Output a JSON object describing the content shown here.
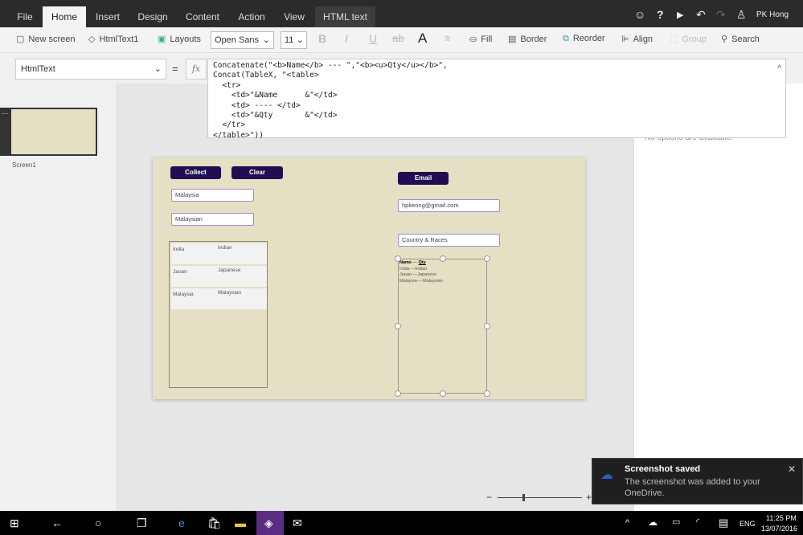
{
  "menu": {
    "tabs": [
      "File",
      "Home",
      "Insert",
      "Design",
      "Content",
      "Action",
      "View",
      "HTML text"
    ],
    "selected": "Home",
    "user": "PK Hong"
  },
  "ribbon": {
    "new_screen": "New screen",
    "control": "HtmlText1",
    "layouts": "Layouts",
    "font": "Open Sans",
    "size": "11",
    "fill": "Fill",
    "border": "Border",
    "reorder": "Reorder",
    "align": "Align",
    "group": "Group",
    "search": "Search"
  },
  "formula_bar": {
    "property": "HtmlText",
    "equals": "=",
    "fx": "fx",
    "formula": "Concatenate(\"<b>Name</b> --- \",\"<b><u>Qty</u></b>\",\nConcat(TableX, \"<table>\n  <tr>\n    <td>\"&Name      &\"</td>\n    <td> ---- </td>\n    <td>\"&Qty       &\"</td>\n  </tr>\n</table>\"))"
  },
  "screens": [
    {
      "name": "Screen1"
    }
  ],
  "right_panel": {
    "message": "No options are available."
  },
  "app": {
    "collect": "Collect",
    "clear": "Clear",
    "email": "Email",
    "input_country": "Malaysia",
    "input_race": "Malaysian",
    "email_value": "hpkeong@gmail.com",
    "subject_value": "Country & Races",
    "gallery": [
      {
        "name": "India",
        "qty": "Indian"
      },
      {
        "name": "Jaoan",
        "qty": "Japanese"
      },
      {
        "name": "Malaysia",
        "qty": "Malaysian"
      }
    ],
    "html_header_name": "Name",
    "html_header_sep": " --- ",
    "html_header_qty": "Qty",
    "html_lines": [
      "India----Indian",
      "Jaoan----Japanese",
      "Malaysia----Malaysian"
    ]
  },
  "zoom": {
    "minus": "−",
    "plus": "+",
    "level": 0.35
  },
  "toast": {
    "title": "Screenshot saved",
    "body": "The screenshot was added to your OneDrive.",
    "accent": "#1e63c8"
  },
  "taskbar": {
    "lang": "ENG",
    "time": "11:25 PM",
    "date": "13/07/2016"
  }
}
